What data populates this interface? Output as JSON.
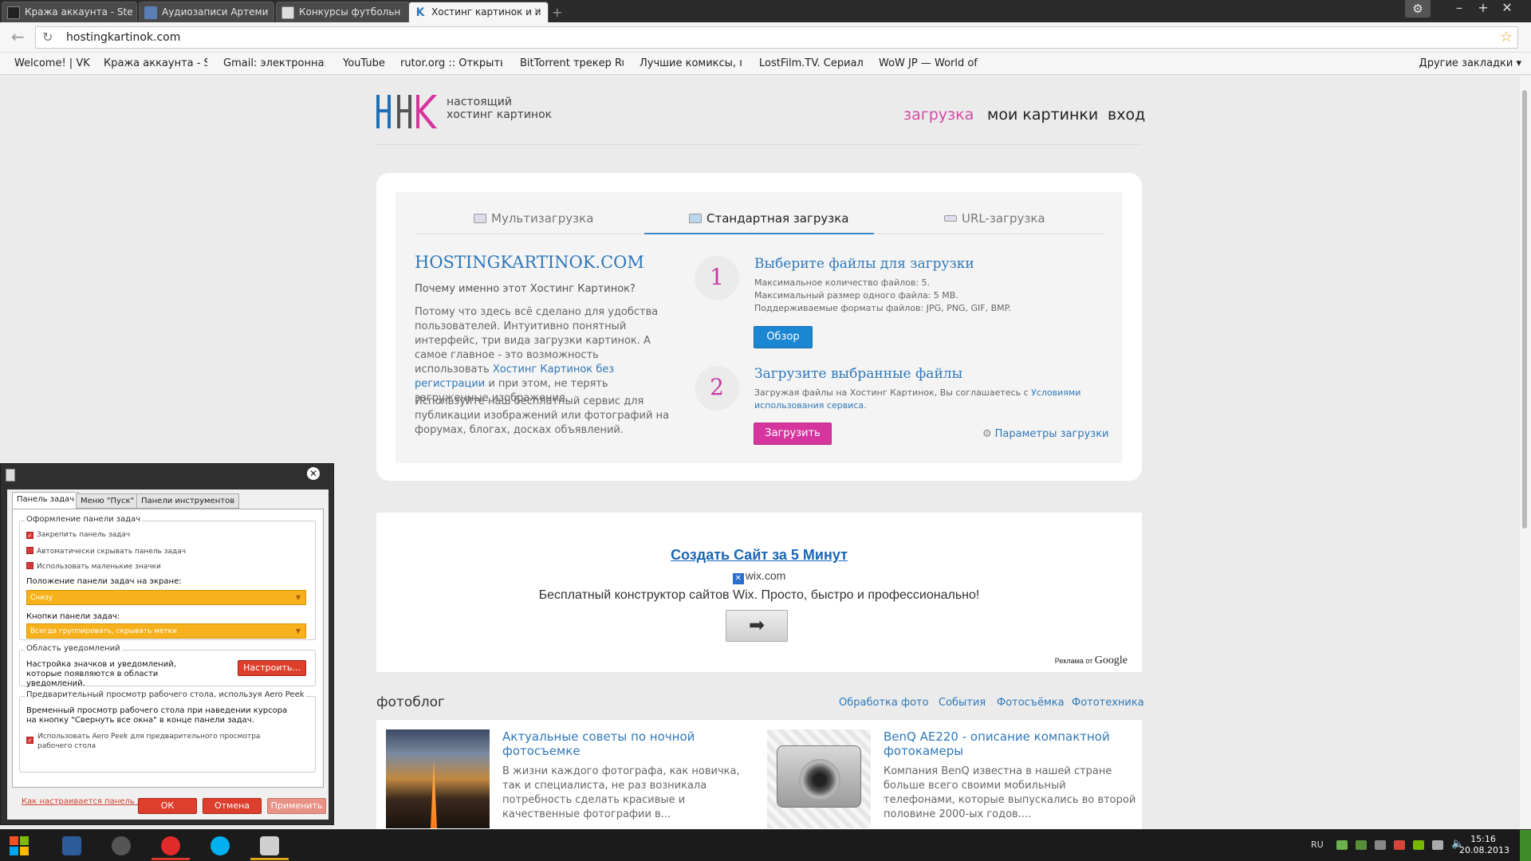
{
  "browser": {
    "tabs": [
      {
        "title": "Кража аккаунта - Ste",
        "icon": "steam-icon",
        "active": false
      },
      {
        "title": "Аудиозаписи Артеми",
        "icon": "audio-icon",
        "active": false
      },
      {
        "title": "Конкурсы футбольн",
        "icon": "document-icon",
        "active": false
      },
      {
        "title": "Хостинг картинок и и",
        "icon": "hk-icon",
        "active": true
      }
    ],
    "url": "hostingkartinok.com",
    "bookmarks": [
      "Welcome! | VK",
      "Кража аккаунта - Ste",
      "Gmail: электронная",
      "YouTube",
      "rutor.org :: Открыты",
      "BitTorrent трекер Ru",
      "Лучшие комиксы, мо",
      "LostFilm.TV. Сериал",
      "WoW JP — World of"
    ],
    "other_bookmarks": "Другие закладки ▾",
    "window_controls": {
      "settings": "⚙",
      "minimize": "–",
      "maximize": "+",
      "close": "✕"
    }
  },
  "site": {
    "logo_text": "настоящий\nхостинг картинок",
    "nav": {
      "upload": "загрузка",
      "my_images": "мои картинки",
      "login": "вход"
    },
    "upload_tabs": {
      "multi": "Мультизагрузка",
      "standard": "Стандартная загрузка",
      "url": "URL-загрузка"
    },
    "intro": {
      "title": "HOSTINGKARTINOK.COM",
      "question": "Почему именно этот Хостинг Картинок?",
      "p1_before": "Потому что здесь всё сделано для удобства пользователей. Интуитивно понятный интерфейс, три вида загрузки картинок. А самое главное - это возможность использовать ",
      "p1_link": "Хостинг Картинок без регистрации",
      "p1_after": " и при этом, не терять загруженные изображения.",
      "p2": "Используйте наш бесплатный сервис для публикации изображений или фотографий на форумах, блогах, досках объявлений."
    },
    "step1": {
      "num": "1",
      "title": "Выберите файлы для загрузки",
      "line1": "Максимальное количество файлов: 5.",
      "line2": "Максимальный размер одного файла: 5 MB.",
      "line3": "Поддерживаемые форматы файлов: JPG, PNG, GIF, BMP.",
      "button": "Обзор"
    },
    "step2": {
      "num": "2",
      "title": "Загрузите выбранные файлы",
      "note_before": "Загружая файлы на Хостинг Картинок, Вы соглашаетесь с ",
      "note_link": "Условиями использования сервиса",
      "note_after": ".",
      "button": "Загрузить",
      "params": "Параметры загрузки"
    },
    "ad": {
      "title": "Создать Сайт за 5 Минут",
      "domain": "wix.com",
      "desc": "Бесплатный конструктор сайтов Wix. Просто, быстро и профессионально!",
      "arrow": "➡",
      "by": "Реклама от",
      "google": "Google"
    },
    "blog": {
      "title": "фотоблог",
      "links": [
        "Обработка фото",
        "События",
        "Фотосъёмка",
        "Фототехника"
      ],
      "posts": [
        {
          "title": "Актуальные советы по ночной фотосъемке",
          "text": "В жизни каждого фотографа, как новичка, так и специалиста, не раз возникала потребность сделать красивые и качественные фотографии в..."
        },
        {
          "title": "BenQ AE220 - описание компактной фотокамеры",
          "text": "Компания BenQ известна в нашей стране больше всего своими мобильный телефонами, которые выпускались во второй половине 2000-ых годов...."
        }
      ]
    }
  },
  "dialog": {
    "tabs": [
      "Панель задач",
      "Меню \"Пуск\"",
      "Панели инструментов"
    ],
    "group1": {
      "legend": "Оформление панели задач",
      "checks": [
        "Закрепить панель задач",
        "Автоматически скрывать панель задач",
        "Использовать маленькие значки"
      ],
      "position_label": "Положение панели задач на экране:",
      "position_value": "Снизу",
      "buttons_label": "Кнопки панели задач:",
      "buttons_value": "Всегда группировать, скрывать метки"
    },
    "group2": {
      "legend": "Область уведомлений",
      "text": "Настройка значков и уведомлений, которые появляются в области уведомлений.",
      "button": "Настроить..."
    },
    "group3": {
      "legend": "Предварительный просмотр рабочего стола, используя Aero Peek",
      "text": "Временный просмотр рабочего стола при наведении курсора на кнопку \"Свернуть все окна\" в конце панели задач.",
      "check": "Использовать Aero Peek для предварительного просмотра рабочего стола"
    },
    "help_link": "Как настраивается панель задач?",
    "ok": "ОК",
    "cancel": "Отмена",
    "apply": "Применить"
  },
  "taskbar": {
    "apps": [
      "thunderbird-icon",
      "steam-icon",
      "yandex-browser-icon",
      "skype-icon",
      "explorer-icon"
    ],
    "lang": "RU",
    "time": "15:16",
    "date": "20.08.2013"
  },
  "colors": {
    "accent_pink": "#d6359e",
    "accent_blue": "#1b87d2",
    "link_blue": "#2f78b9",
    "dialog_red": "#dd3f2c",
    "select_orange": "#f6b11c"
  }
}
